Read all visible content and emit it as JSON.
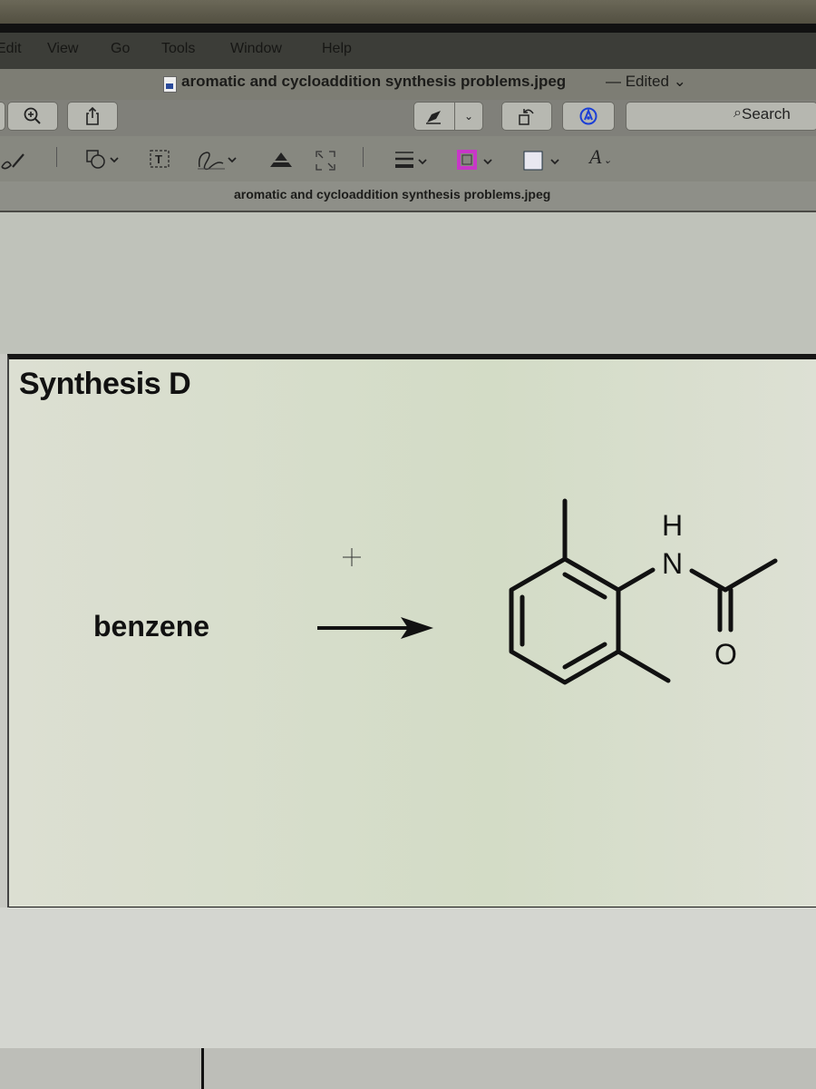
{
  "menu": [
    "Edit",
    "View",
    "Go",
    "Tools",
    "Window",
    "Help"
  ],
  "window": {
    "title": "aromatic and cycloaddition synthesis problems.jpeg",
    "status": "— Edited ⌄"
  },
  "toolbar": {
    "zoom_icon": "zoom-in-icon",
    "share_icon": "share-icon",
    "markup_icon": "pen-icon",
    "rotate_icon": "rotate-icon",
    "annotate_icon": "markup-icon",
    "search_placeholder": "Search"
  },
  "markup_toolbar": {
    "tools": [
      "sketch",
      "shapes",
      "text",
      "sign",
      "adjust-color",
      "adjust-size",
      "shape-style",
      "border-color",
      "fill-color",
      "text-style"
    ],
    "border_color": "#c837c8",
    "fill_color": "#e8e8f0",
    "text_style_glyph": "A"
  },
  "document": {
    "filename": "aromatic and cycloaddition synthesis problems.jpeg",
    "heading": "Synthesis D",
    "reactant": "benzene",
    "product": "N-(2,6-dimethylphenyl)acetamide",
    "atom_labels": {
      "H": "H",
      "N": "N",
      "O": "O"
    }
  }
}
